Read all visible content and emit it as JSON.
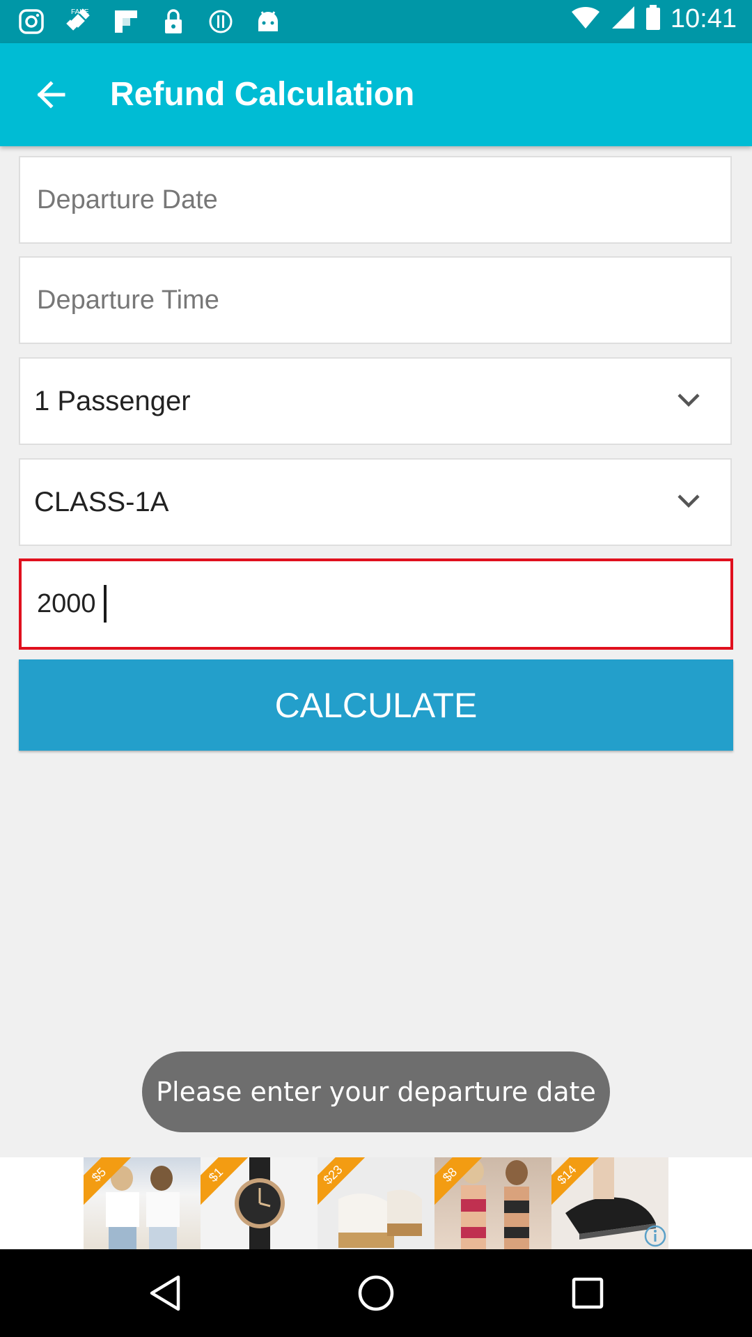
{
  "status_bar": {
    "time": "10:41",
    "icons": [
      "instagram-icon",
      "fake-gps-icon",
      "flipboard-icon",
      "lock-icon",
      "info-icon",
      "android-icon",
      "wifi-icon",
      "signal-icon",
      "battery-icon"
    ]
  },
  "app_bar": {
    "title": "Refund Calculation",
    "back_icon": "arrow-back-icon"
  },
  "form": {
    "departure_date_placeholder": "Departure Date",
    "departure_time_placeholder": "Departure Time",
    "passenger_selected": "1 Passenger",
    "class_selected": "CLASS-1A",
    "amount_value": "2000",
    "calculate_label": "CALCULATE"
  },
  "toast": {
    "message": "Please enter your departure date"
  },
  "ad": {
    "prices": [
      "$5",
      "$1",
      "$23",
      "$8",
      "$14"
    ]
  },
  "colors": {
    "status_bar": "#0097a7",
    "app_bar": "#00bcd4",
    "button": "#239fcb",
    "error_border": "#e0101e",
    "toast": "#6e6e6e"
  }
}
